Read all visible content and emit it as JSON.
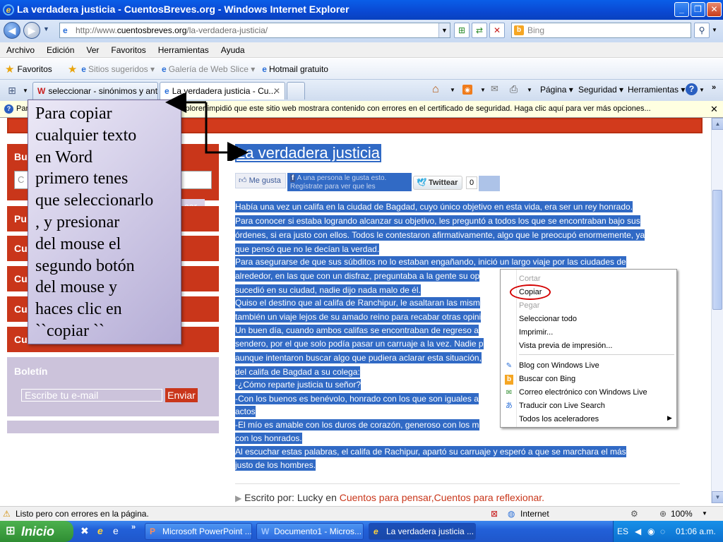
{
  "window": {
    "title": "La verdadera justicia - CuentosBreves.org - Windows Internet Explorer"
  },
  "address": {
    "url_prefix": "http://www.",
    "url_domain": "cuentosbreves.org",
    "url_path": "/la-verdadera-justicia/",
    "search_placeholder": "Bing"
  },
  "menu": [
    "Archivo",
    "Edición",
    "Ver",
    "Favoritos",
    "Herramientas",
    "Ayuda"
  ],
  "favorites": {
    "label": "Favoritos",
    "items": [
      "Sitios sugeridos ▾",
      "Galería de Web Slice ▾",
      "Hotmail gratuito"
    ]
  },
  "tabs": [
    {
      "label": "seleccionar - sinónimos y ant..."
    },
    {
      "label": "La verdadera justicia - Cu..."
    }
  ],
  "commands": [
    "Página ▾",
    "Seguridad ▾",
    "Herramientas ▾"
  ],
  "infobar": {
    "text_left": "Par",
    "text_right": "xplorer impidió que este sitio web mostrara contenido con errores en el certificado de seguridad. Haga clic aquí para ver más opciones..."
  },
  "sidebar": {
    "search_title": "Bu",
    "search_button": "car",
    "search_input": "C",
    "items": [
      "Pu",
      "Cu",
      "Cu",
      "Cu",
      "Cu"
    ],
    "boletin_title": "Boletín",
    "email_placeholder": "Escribe tu e-mail",
    "send_button": "Enviar"
  },
  "article": {
    "title": "La verdadera justicia",
    "like_label": "Me gusta",
    "fb_text1": "A una persona le gusta esto.",
    "fb_text2": "Regístrate para ver que les",
    "tweet_label": "Twittear",
    "tweet_count": "0",
    "lines": [
      "Había una vez un califa en la ciudad de Bagdad, cuyo único objetivo en esta vida, era ser un rey honrado.",
      "Para conocer si estaba logrando alcanzar su objetivo, les preguntó a todos los que se encontraban bajo sus",
      "órdenes, si era justo con ellos. Todos le contestaron afirmativamente, algo que le preocupó enormemente, ya",
      "que pensó que no le decían la verdad.",
      "Para asegurarse de que sus súbditos no lo estaban engañando, inició un largo viaje  por las ciudades de",
      "alrededor, en las que con un disfraz, preguntaba a la gente su op",
      "sucedió en su ciudad, nadie dijo nada malo de él.",
      "Quiso el destino que al califa de Ranchipur, le asaltaran las mism",
      "también un viaje lejos de su amado reino para recabar otras opini",
      "Un buen día, cuando ambos califas se encontraban de regreso a",
      "sendero, por el que solo podía pasar un carruaje a la vez. Nadie p",
      "aunque intentaron buscar algo que pudiera aclarar esta situación,",
      "del califa de Bagdad a su colega:",
      "-¿Cómo reparte justicia tu señor?",
      "-Con los buenos es benévolo, honrado con los que son iguales a",
      "actos",
      "-El mío es amable con los duros de corazón, generoso con los m",
      "con los honrados.",
      "Al escuchar estas palabras, el califa de Rachipur, apartó su carruaje y esperó a que se marchara el más",
      "justo de los hombres."
    ],
    "footer_prefix": "Escrito por: Lucky en ",
    "footer_links": "Cuentos para pensar,Cuentos para reflexionar."
  },
  "context_menu": {
    "items": [
      "Cortar",
      "Copiar",
      "Pegar",
      "Seleccionar todo",
      "Imprimir...",
      "Vista previa de impresión...",
      "Blog con Windows Live",
      "Buscar con Bing",
      "Correo electrónico con Windows Live",
      "Traducir con Live Search",
      "Todos los aceleradores"
    ],
    "disabled": [
      true,
      false,
      true,
      false,
      false,
      false,
      false,
      false,
      false,
      false,
      false
    ],
    "highlight_color": "#d40000"
  },
  "callout": {
    "text": "Para copiar\ncualquier texto\nen Word\nprimero tenes\nque seleccionarlo\n,   y presionar\ndel mouse el\nsegundo  botón\ndel  mouse  y\nhaces clic en\n``copiar ``"
  },
  "statusbar": {
    "text": "Listo pero con errores en la página.",
    "zone": "Internet",
    "zoom": "100%"
  },
  "taskbar": {
    "start": "Inicio",
    "tasks": [
      "Microsoft PowerPoint ...",
      "Documento1 - Micros...",
      "La verdadera justicia ..."
    ],
    "lang": "ES",
    "clock": "01:06 a.m."
  },
  "colors": {
    "selection": "#316ac5",
    "site_red": "#c9361a",
    "title_blue": "#0a48d2"
  }
}
